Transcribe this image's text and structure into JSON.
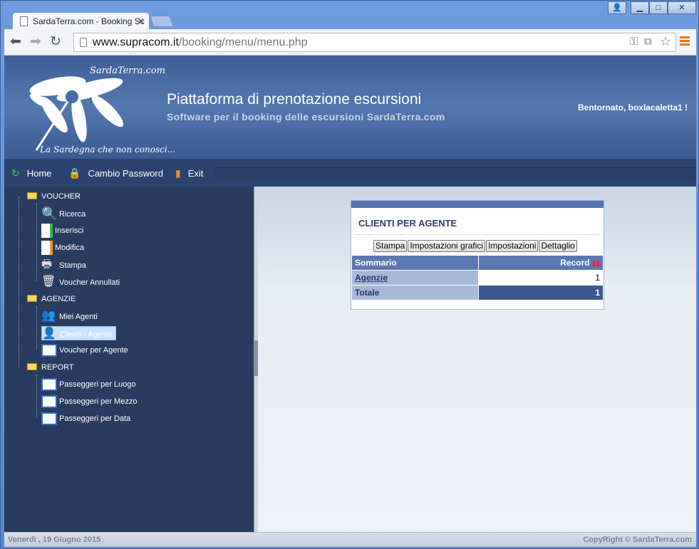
{
  "browser": {
    "tab_title": "SardaTerra.com - Booking Sc",
    "url_host": "www.supracom.it",
    "url_path": "/booking/menu/menu.php"
  },
  "header": {
    "brand_top": "SardaTerra.com",
    "brand_tagline": "La Sardegna che non conosci...",
    "title": "Piattaforma di prenotazione escursioni",
    "subtitle": "Software per il booking delle escursioni SardaTerra.com",
    "welcome": "Bentornato, boxlacaletta1 !"
  },
  "navbar": {
    "home": "Home",
    "change_password": "Cambio Password",
    "exit": "Exit"
  },
  "tree": {
    "voucher": {
      "label": "VOUCHER",
      "items": [
        "Ricerca",
        "Inserisci",
        "Modifica",
        "Stampa",
        "Voucher Annullati"
      ]
    },
    "agenzie": {
      "label": "AGENZIE",
      "items": [
        "Miei Agenti",
        "Clienti / Agente",
        "Voucher per Agente"
      ]
    },
    "report": {
      "label": "REPORT",
      "items": [
        "Passeggeri per Luogo",
        "Passeggeri per Mezzo",
        "Passeggeri per Data"
      ]
    }
  },
  "panel": {
    "title": "CLIENTI PER AGENTE",
    "buttons": [
      "Stampa",
      "Impostazioni grafici",
      "Impostazioni",
      "Dettaglio"
    ],
    "col_summary": "Sommario",
    "col_record": "Record",
    "row_label": "Agenzie",
    "row_value": "1",
    "total_label": "Totale",
    "total_value": "1"
  },
  "footer": {
    "date": "Venerdì , 19 Giugno 2015",
    "copyright": "CopyRight © SardaTerra.com"
  },
  "colors": {
    "header_blue": "#4a6aa3",
    "sidebar_bg": "#293c60",
    "table_header": "#5c78b2"
  }
}
